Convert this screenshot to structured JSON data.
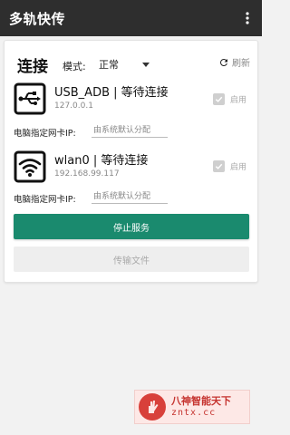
{
  "appbar": {
    "title": "多轨快传",
    "menu_icon": "more-vert-icon"
  },
  "connection": {
    "title": "连接",
    "mode_label": "模式:",
    "mode_value": "正常",
    "refresh_label": "刷新"
  },
  "devices": [
    {
      "icon": "usb-icon",
      "name": "USB_ADB | 等待连接",
      "address": "127.0.0.1",
      "enable_label": "启用",
      "enabled": true,
      "ip_label": "电脑指定网卡IP:",
      "ip_placeholder": "由系统默认分配"
    },
    {
      "icon": "wifi-icon",
      "name": "wlan0 | 等待连接",
      "address": "192.168.99.117",
      "enable_label": "启用",
      "enabled": true,
      "ip_label": "电脑指定网卡IP:",
      "ip_placeholder": "由系统默认分配"
    }
  ],
  "actions": {
    "stop_label": "停止服务",
    "transfer_label": "传输文件"
  },
  "watermark": {
    "line1": "八神智能天下",
    "line2": "zntx.cc"
  },
  "colors": {
    "appbar": "#2e2e2e",
    "primary": "#1a8a6e",
    "disabled": "#eeeeee"
  }
}
